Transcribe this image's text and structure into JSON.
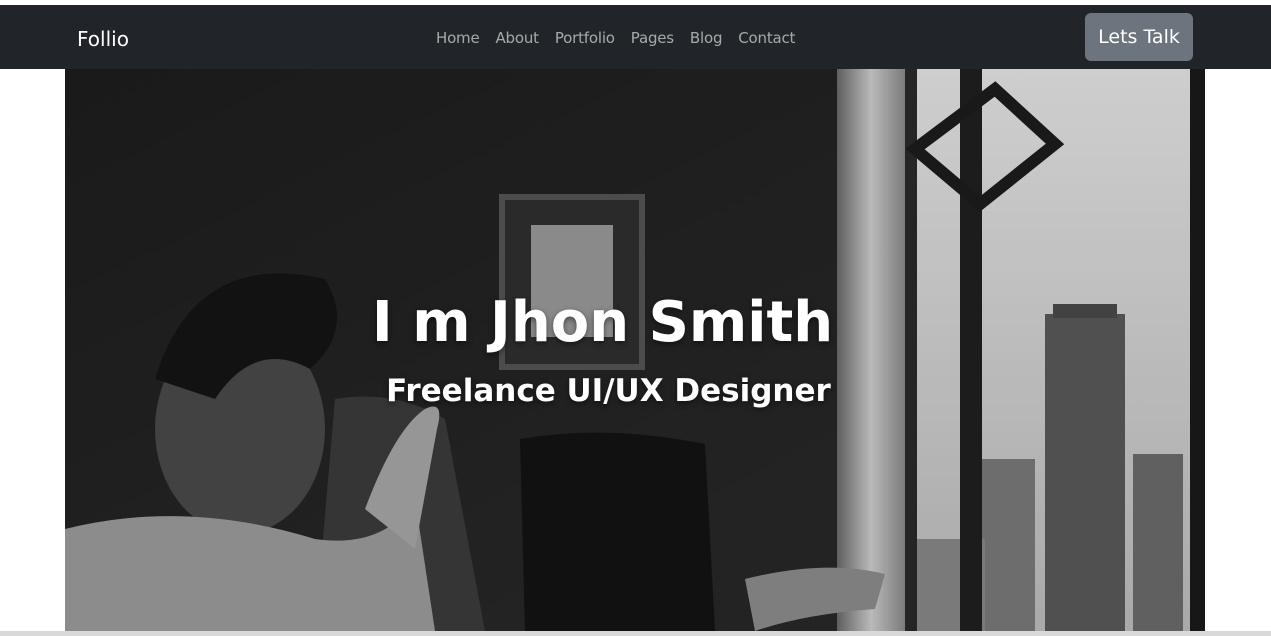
{
  "navbar": {
    "brand": "Follio",
    "links": [
      {
        "label": "Home"
      },
      {
        "label": "About"
      },
      {
        "label": "Portfolio"
      },
      {
        "label": "Pages"
      },
      {
        "label": "Blog"
      },
      {
        "label": "Contact"
      }
    ],
    "cta_label": "Lets Talk"
  },
  "hero": {
    "title": "I m Jhon Smith",
    "subtitle": "Freelance UI/UX Designer"
  },
  "colors": {
    "navbar_bg": "#212529",
    "cta_bg": "#6c757d",
    "hero_text": "#ffffff"
  }
}
